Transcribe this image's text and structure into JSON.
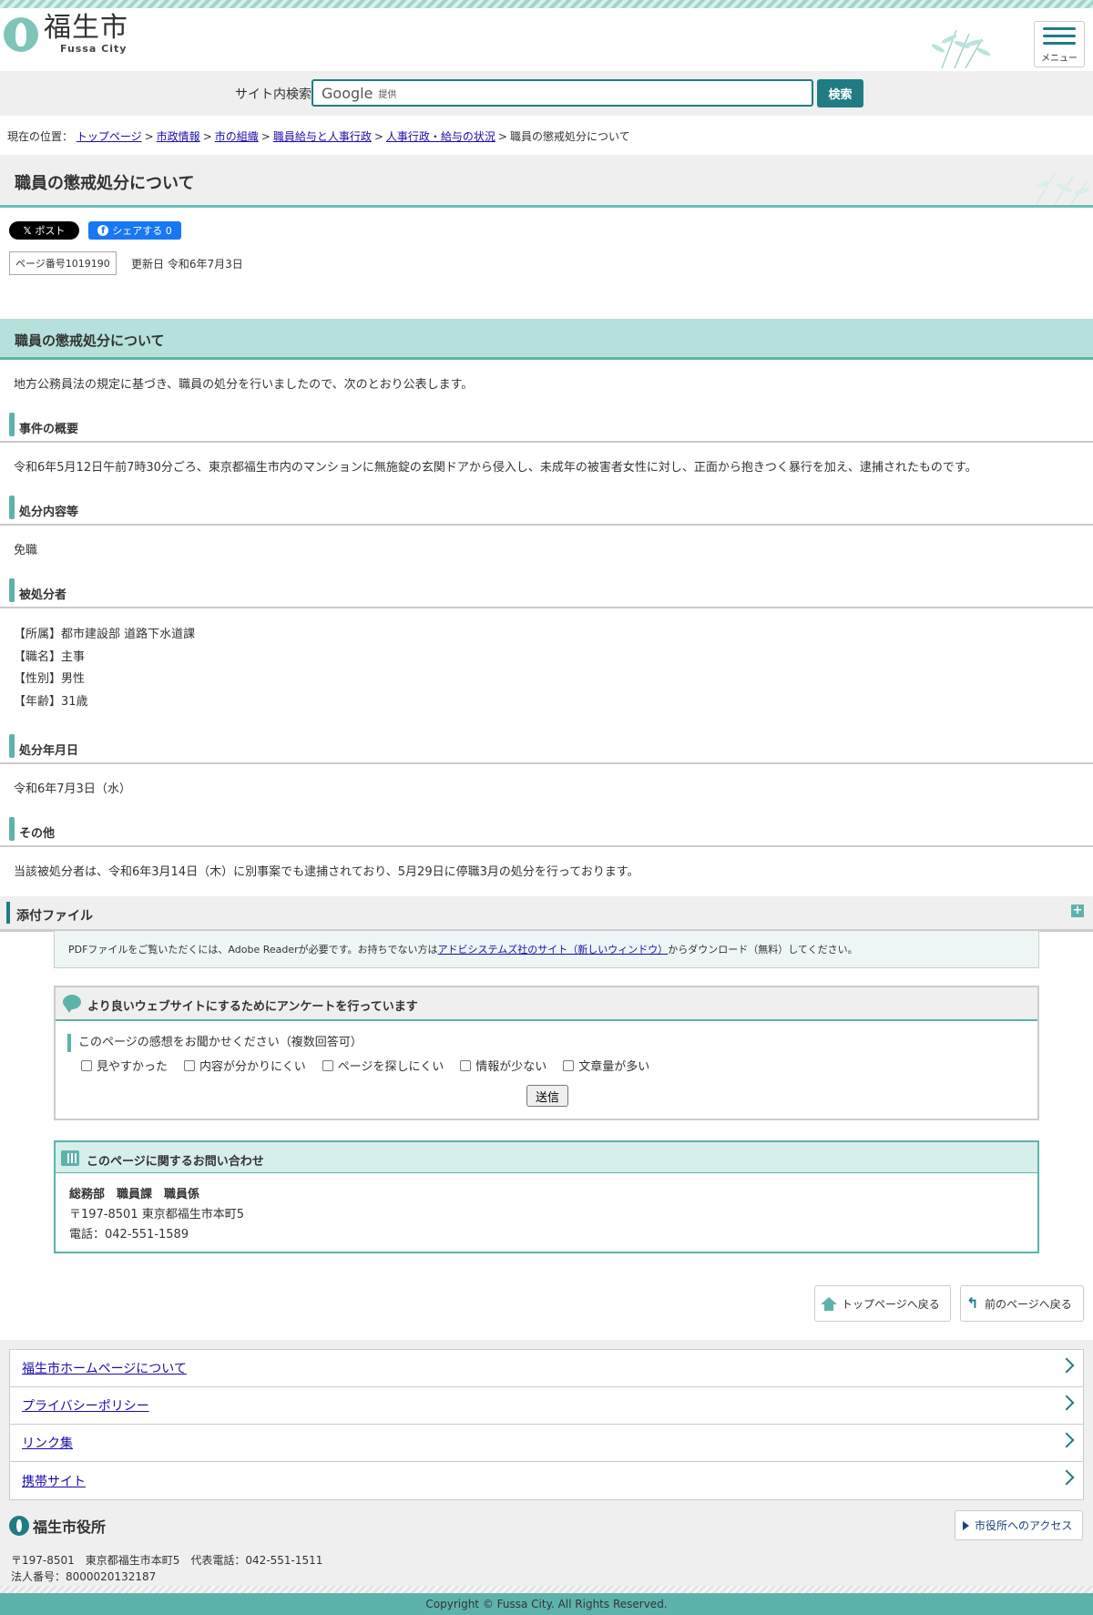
{
  "header": {
    "logo_jp": "福生市",
    "logo_en": "Fussa City",
    "menu_label": "メニュー"
  },
  "search": {
    "label": "サイト内検索",
    "google": "Google",
    "google_sub": "提供",
    "button": "検索"
  },
  "breadcrumb": {
    "prefix": "現在の位置：",
    "items": [
      "トップページ",
      "市政情報",
      "市の組織",
      "職員給与と人事行政",
      "人事行政・給与の状況"
    ],
    "current": "職員の懲戒処分について",
    "separator": ">"
  },
  "page": {
    "title": "職員の懲戒処分について",
    "share_x": "ポスト",
    "share_fb": "シェアする 0",
    "page_no": "ページ番号1019190",
    "updated": "更新日 令和6年7月3日"
  },
  "content": {
    "section_title": "職員の懲戒処分について",
    "intro": "地方公務員法の規定に基づき、職員の処分を行いましたので、次のとおり公表します。",
    "h_overview": "事件の概要",
    "overview": "令和6年5月12日午前7時30分ごろ、東京都福生市内のマンションに無施錠の玄関ドアから侵入し、未成年の被害者女性に対し、正面から抱きつく暴行を加え、逮捕されたものです。",
    "h_disposal": "処分内容等",
    "disposal": "免職",
    "h_subject": "被処分者",
    "subject_lines": [
      "【所属】都市建設部 道路下水道課",
      "【職名】主事",
      "【性別】男性",
      "【年齢】31歳"
    ],
    "h_date": "処分年月日",
    "date": "令和6年7月3日（水）",
    "h_other": "その他",
    "other": "当該被処分者は、令和6年3月14日（木）に別事案でも逮捕されており、5月29日に停職3月の処分を行っております。"
  },
  "attach": {
    "label": "添付ファイル",
    "pdf_note_before": "PDFファイルをご覧いただくには、Adobe Readerが必要です。お持ちでない方は",
    "pdf_note_link": "アドビシステムズ社のサイト（新しいウィンドウ）",
    "pdf_note_after": "からダウンロード（無料）してください。"
  },
  "survey": {
    "title": "より良いウェブサイトにするためにアンケートを行っています",
    "question": "このページの感想をお聞かせください（複数回答可）",
    "options": [
      "見やすかった",
      "内容が分かりにくい",
      "ページを探しにくい",
      "情報が少ない",
      "文章量が多い"
    ],
    "submit": "送信"
  },
  "contact": {
    "title": "このページに関するお問い合わせ",
    "dept": "総務部　職員課　職員係",
    "address": "〒197-8501 東京都福生市本町5",
    "tel": "電話：042-551-1589"
  },
  "nav_back": {
    "top": "トップページへ戻る",
    "prev": "前のページへ戻る"
  },
  "footer": {
    "links": [
      "福生市ホームページについて",
      "プライバシーポリシー",
      "リンク集",
      "携帯サイト"
    ],
    "office": "福生市役所",
    "access": "市役所へのアクセス",
    "address": "〒197-8501　東京都福生市本町5　代表電話：042-551-1511",
    "corp_no": "法人番号：8000020132187",
    "copyright": "Copyright © Fussa City. All Rights Reserved."
  },
  "colors": {
    "accent": "#1f7c82",
    "accent_light": "#5db3ac",
    "band": "#b5e1da"
  }
}
